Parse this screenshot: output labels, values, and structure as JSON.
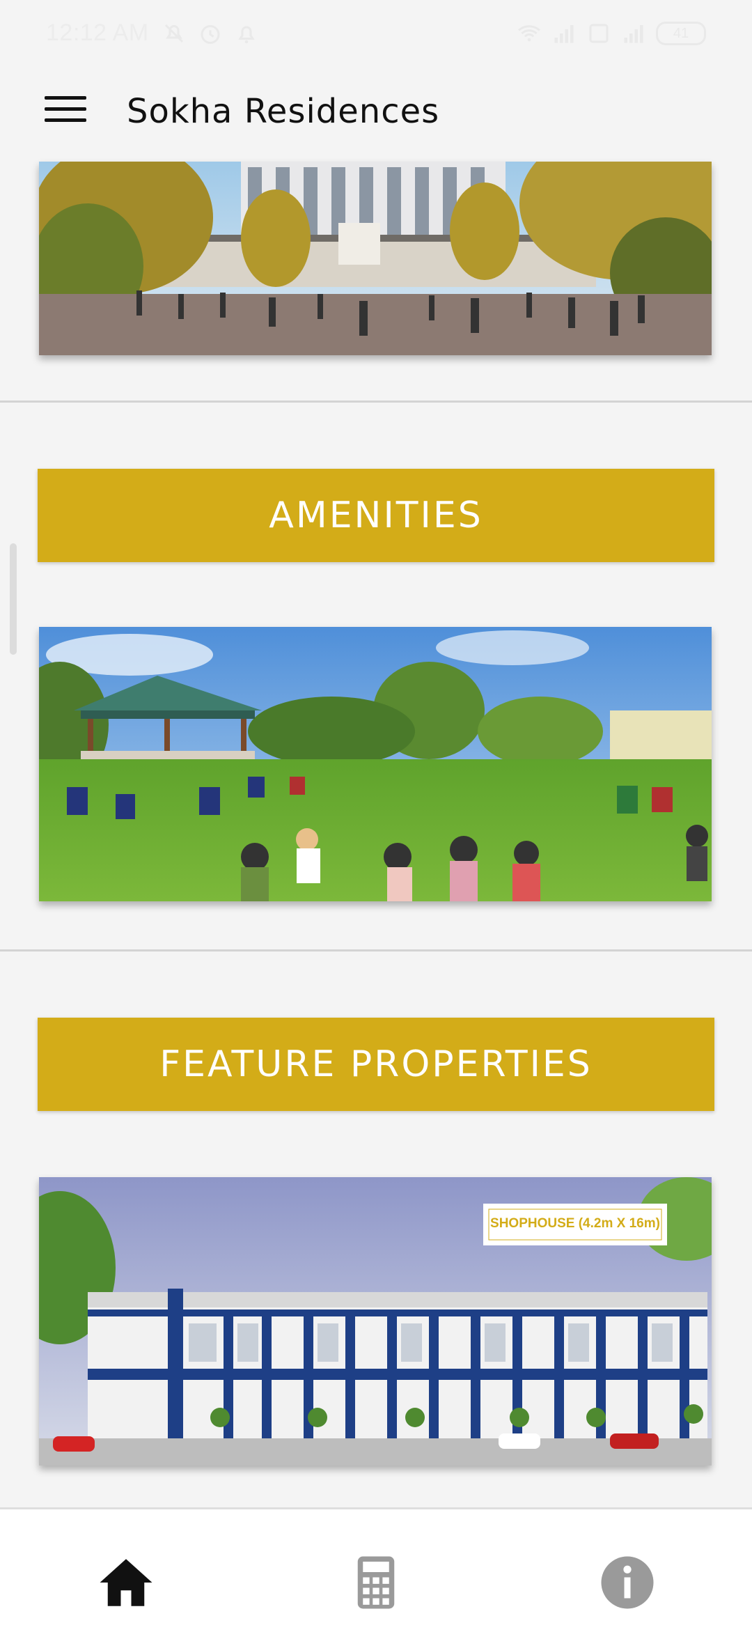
{
  "status_bar": {
    "time": "12:12 AM",
    "battery": "41"
  },
  "app_bar": {
    "title": "Sokha Residences",
    "menu_icon": "hamburger-menu-icon"
  },
  "sections": {
    "amenities_title": "AMENITIES",
    "feature_title": "FEATURE PROPERTIES",
    "shophouse_label": "SHOPHOUSE (4.2m X 16m)"
  },
  "bottom_nav": {
    "items": [
      {
        "icon": "home-icon",
        "active": true
      },
      {
        "icon": "calculator-icon",
        "active": false
      },
      {
        "icon": "info-icon",
        "active": false
      }
    ]
  },
  "colors": {
    "banner": "#d3ac18",
    "background": "#f4f4f4",
    "nav_active": "#111111",
    "nav_inactive": "#9a9a9a"
  }
}
